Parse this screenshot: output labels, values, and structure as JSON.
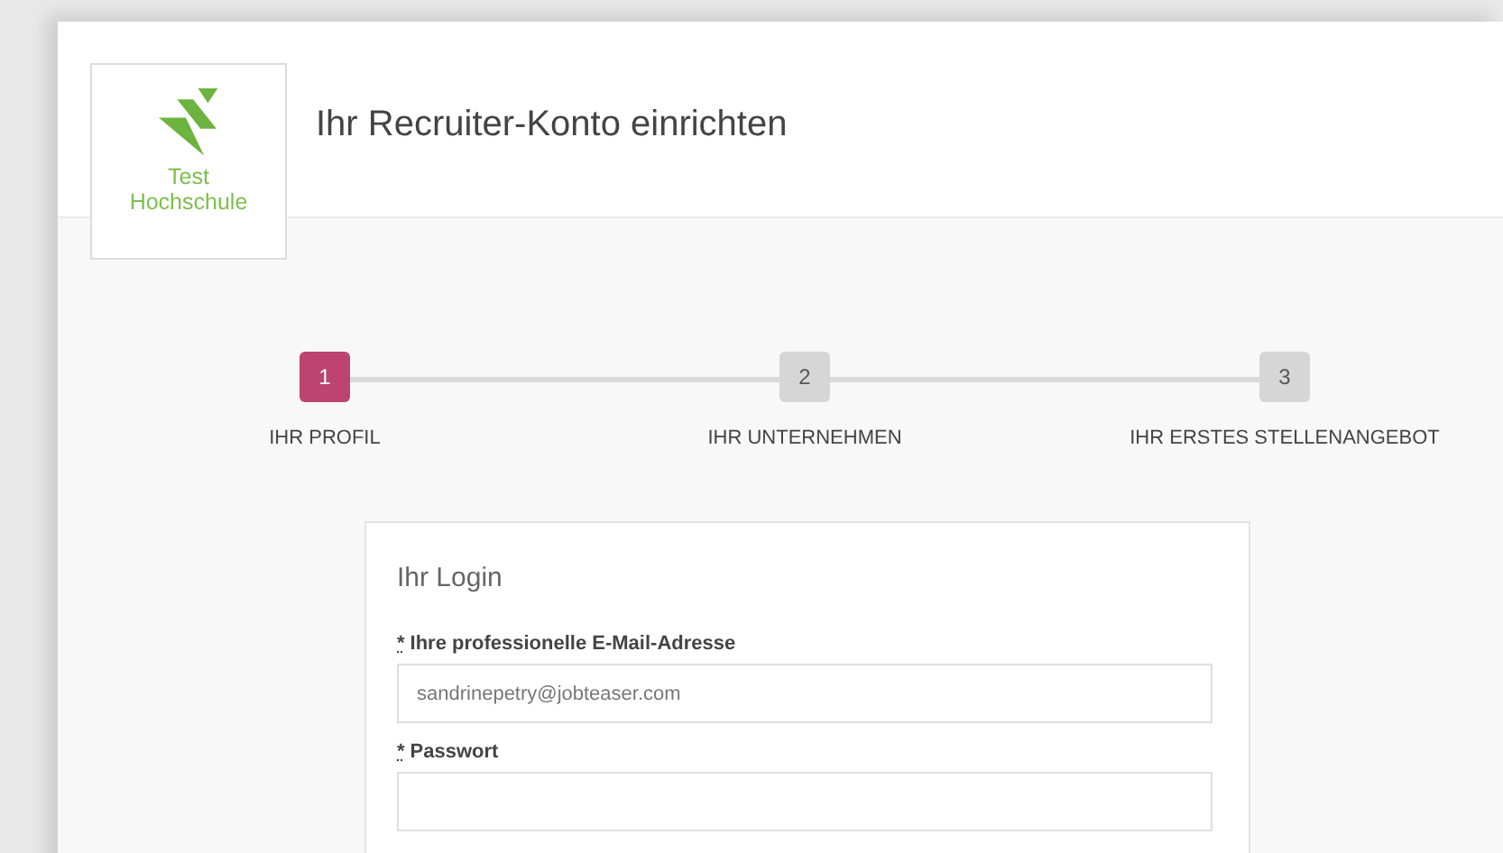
{
  "logo": {
    "line_1": "Test",
    "line_2": "Hochschule"
  },
  "page_title": "Ihr Recruiter-Konto einrichten",
  "steps": [
    {
      "number": "1",
      "label": "IHR PROFIL",
      "selected": true
    },
    {
      "number": "2",
      "label": "IHR UNTERNEHMEN",
      "selected": false
    },
    {
      "number": "3",
      "label": "IHR ERSTES STELLENANGEBOT",
      "selected": false
    }
  ],
  "card": {
    "title": "Ihr Login",
    "fields": [
      {
        "required_mark": "*",
        "label": "Ihre professionelle E-Mail-Adresse",
        "value": "sandrinepetry@jobteaser.com"
      },
      {
        "required_mark": "*",
        "label": "Passwort"
      }
    ]
  }
}
